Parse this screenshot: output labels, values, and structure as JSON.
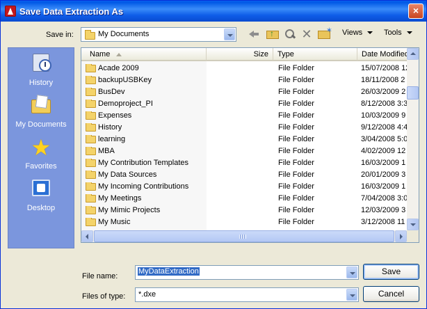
{
  "window": {
    "title": "Save Data Extraction As",
    "close_label": "×"
  },
  "save_in": {
    "label": "Save in:",
    "value": "My Documents"
  },
  "toolbar": {
    "views_label": "Views",
    "tools_label": "Tools"
  },
  "places": [
    {
      "label": "History",
      "icon": "history-icon"
    },
    {
      "label": "My Documents",
      "icon": "my-documents-icon"
    },
    {
      "label": "Favorites",
      "icon": "favorites-star-icon"
    },
    {
      "label": "Desktop",
      "icon": "desktop-icon"
    }
  ],
  "columns": {
    "name": "Name",
    "size": "Size",
    "type": "Type",
    "date": "Date Modified"
  },
  "files": [
    {
      "name": "Acade 2009",
      "type": "File Folder",
      "date": "15/07/2008 12:"
    },
    {
      "name": "backupUSBKey",
      "type": "File Folder",
      "date": "18/11/2008 2"
    },
    {
      "name": "BusDev",
      "type": "File Folder",
      "date": "26/03/2009 2"
    },
    {
      "name": "Demoproject_PI",
      "type": "File Folder",
      "date": "8/12/2008 3:3"
    },
    {
      "name": "Expenses",
      "type": "File Folder",
      "date": "10/03/2009 9"
    },
    {
      "name": "History",
      "type": "File Folder",
      "date": "9/12/2008 4:4"
    },
    {
      "name": "learning",
      "type": "File Folder",
      "date": "3/04/2008 5:0"
    },
    {
      "name": "MBA",
      "type": "File Folder",
      "date": "4/02/2009 12"
    },
    {
      "name": "My Contribution Templates",
      "type": "File Folder",
      "date": "16/03/2009 1"
    },
    {
      "name": "My Data Sources",
      "type": "File Folder",
      "date": "20/01/2009 3"
    },
    {
      "name": "My Incoming Contributions",
      "type": "File Folder",
      "date": "16/03/2009 1"
    },
    {
      "name": "My Meetings",
      "type": "File Folder",
      "date": "7/04/2008 3:0"
    },
    {
      "name": "My Mimic Projects",
      "type": "File Folder",
      "date": "12/03/2009 3"
    },
    {
      "name": "My Music",
      "type": "File Folder",
      "date": "3/12/2008 11"
    }
  ],
  "file_name": {
    "label": "File name:",
    "value": "MyDataExtraction"
  },
  "file_type": {
    "label": "Files of type:",
    "value": "*.dxe"
  },
  "buttons": {
    "save": "Save",
    "cancel": "Cancel"
  }
}
